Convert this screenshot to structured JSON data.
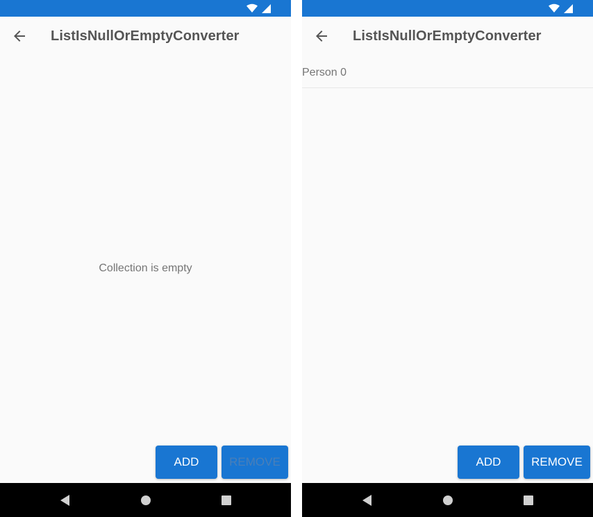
{
  "screens": [
    {
      "app_bar": {
        "title": "ListIsNullOrEmptyConverter"
      },
      "empty_message": "Collection is empty",
      "items": [],
      "buttons": {
        "add": "ADD",
        "remove": "REMOVE",
        "remove_enabled": false
      }
    },
    {
      "app_bar": {
        "title": "ListIsNullOrEmptyConverter"
      },
      "items": [
        "Person 0"
      ],
      "buttons": {
        "add": "ADD",
        "remove": "REMOVE",
        "remove_enabled": true
      }
    }
  ],
  "colors": {
    "primary": "#1976d2",
    "background": "#fafafa",
    "nav_bar": "#000000",
    "secondary_text": "#757575",
    "disabled_button_text": "#4a7fb8"
  },
  "icons": {
    "status": [
      "wifi-icon",
      "cell-signal-icon"
    ],
    "app_bar": "arrow-back-icon",
    "nav": [
      "nav-back-icon",
      "nav-home-icon",
      "nav-recents-icon"
    ]
  }
}
